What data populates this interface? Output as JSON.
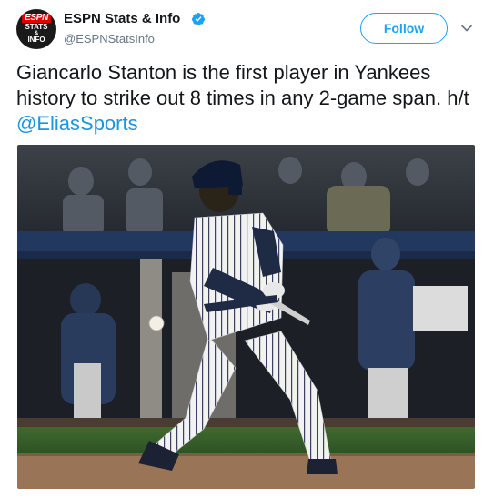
{
  "account": {
    "display_name": "ESPN Stats & Info",
    "handle": "@ESPNStatsInfo",
    "verified": true,
    "avatar_logo": {
      "line1": "ESPN",
      "line2": "STATS",
      "line3": "&",
      "line4": "INFO"
    }
  },
  "follow_button": {
    "label": "Follow"
  },
  "menu": {
    "icon": "chevron-down-icon"
  },
  "tweet": {
    "text": "Giancarlo Stanton is the first player in Yankees history to strike out 8 times in any 2-game span. h/t ",
    "mention": "@EliasSports"
  },
  "colors": {
    "accent": "#1da1f2",
    "link": "#1b95e0",
    "text": "#14171a",
    "muted": "#657786"
  }
}
